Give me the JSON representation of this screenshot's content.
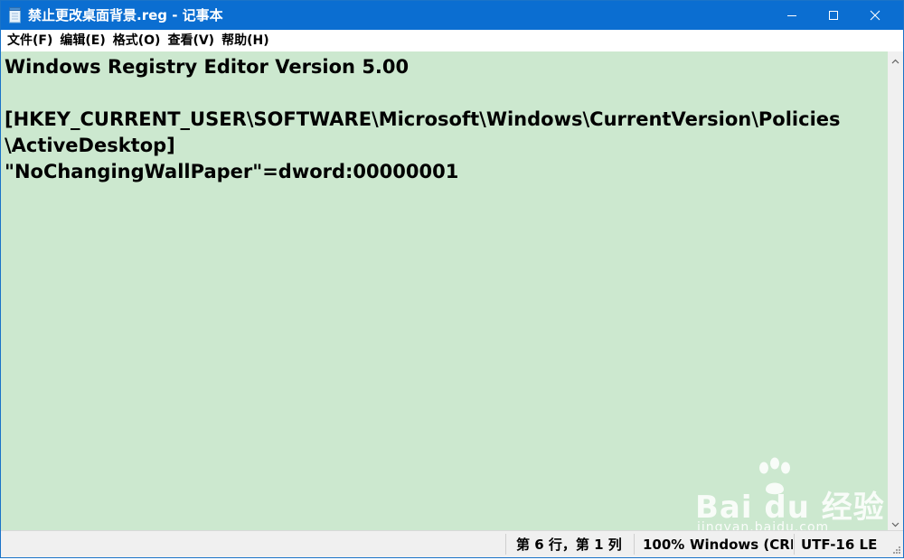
{
  "window": {
    "title": "禁止更改桌面背景.reg - 记事本",
    "controls": [
      "minimize",
      "maximize",
      "close"
    ]
  },
  "menu": {
    "items": [
      "文件(F)",
      "编辑(E)",
      "格式(O)",
      "查看(V)",
      "帮助(H)"
    ]
  },
  "editor": {
    "lines": [
      "Windows Registry Editor Version 5.00",
      "",
      "[HKEY_CURRENT_USER\\SOFTWARE\\Microsoft\\Windows\\CurrentVersion\\Policies",
      "\\ActiveDesktop]",
      "\"NoChangingWallPaper\"=dword:00000001"
    ],
    "background_color": "#cce8cf"
  },
  "statusbar": {
    "position": "第 6 行，第 1 列",
    "zoom": "100%",
    "line_ending": "Windows (CRLF)",
    "encoding": "UTF-16 LE"
  },
  "watermark": {
    "brand": "Bai du 经验",
    "url": "jingyan.baidu.com"
  },
  "colors": {
    "titlebar": "#0b6ed1",
    "editor_bg": "#cce8cf",
    "chrome_bg": "#f0f0f0"
  }
}
